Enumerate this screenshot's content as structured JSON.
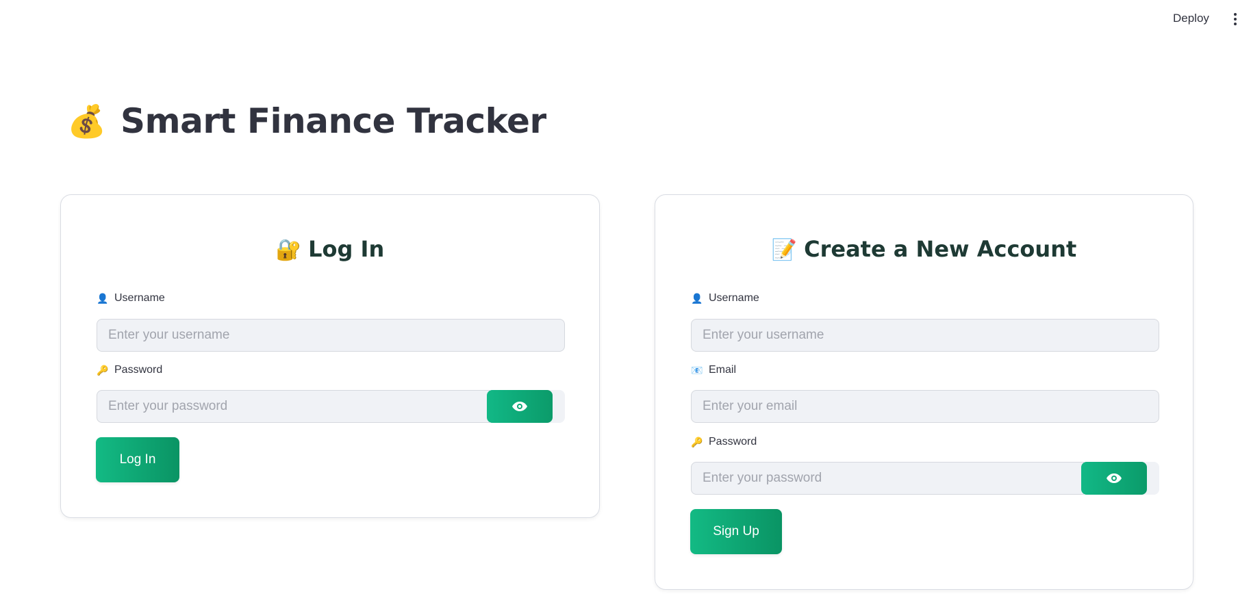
{
  "topbar": {
    "deploy_label": "Deploy",
    "menu_icon": "vertical-dots-icon"
  },
  "page": {
    "title": "Smart Finance Tracker",
    "title_emoji": "💰"
  },
  "login": {
    "heading": "Log In",
    "heading_emoji": "🔐",
    "username_label": "Username",
    "username_icon": "👤",
    "username_placeholder": "Enter your username",
    "password_label": "Password",
    "password_icon": "🔑",
    "password_placeholder": "Enter your password",
    "submit_label": "Log In"
  },
  "signup": {
    "heading": "Create a New Account",
    "heading_emoji": "📝",
    "username_label": "Username",
    "username_icon": "👤",
    "username_placeholder": "Enter your username",
    "email_label": "Email",
    "email_icon": "📧",
    "email_placeholder": "Enter your email",
    "password_label": "Password",
    "password_icon": "🔑",
    "password_placeholder": "Enter your password",
    "submit_label": "Sign Up"
  },
  "colors": {
    "accent": "#12b886",
    "heading": "#1e3a34",
    "text": "#31333f",
    "input_bg": "#f0f2f6"
  }
}
